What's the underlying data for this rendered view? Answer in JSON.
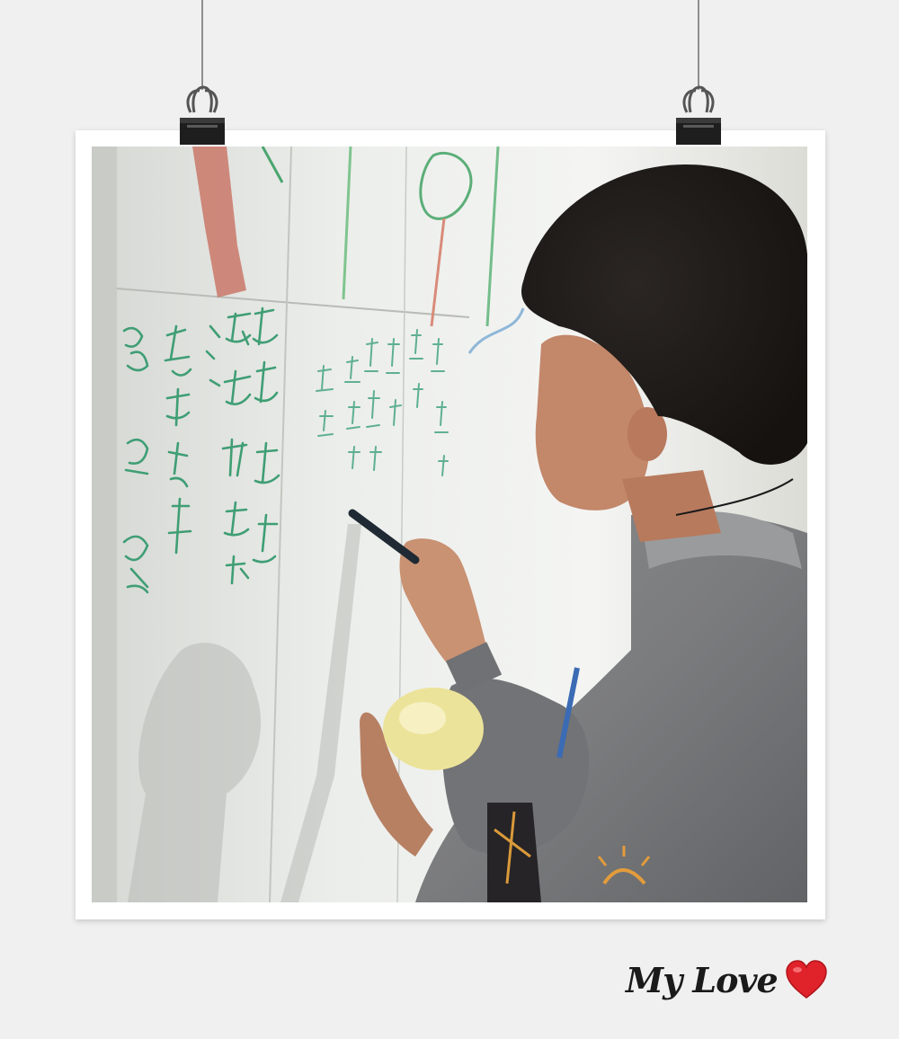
{
  "photo": {
    "subject": "child-writing-on-whiteboard",
    "frame_color": "#ffffff",
    "background_color": "#f1f0f0"
  },
  "clips": [
    {
      "icon": "binder-clip-icon"
    },
    {
      "icon": "binder-clip-icon"
    }
  ],
  "caption": {
    "text": "My Love",
    "icon": "heart-icon",
    "heart_color": "#e0222a"
  }
}
